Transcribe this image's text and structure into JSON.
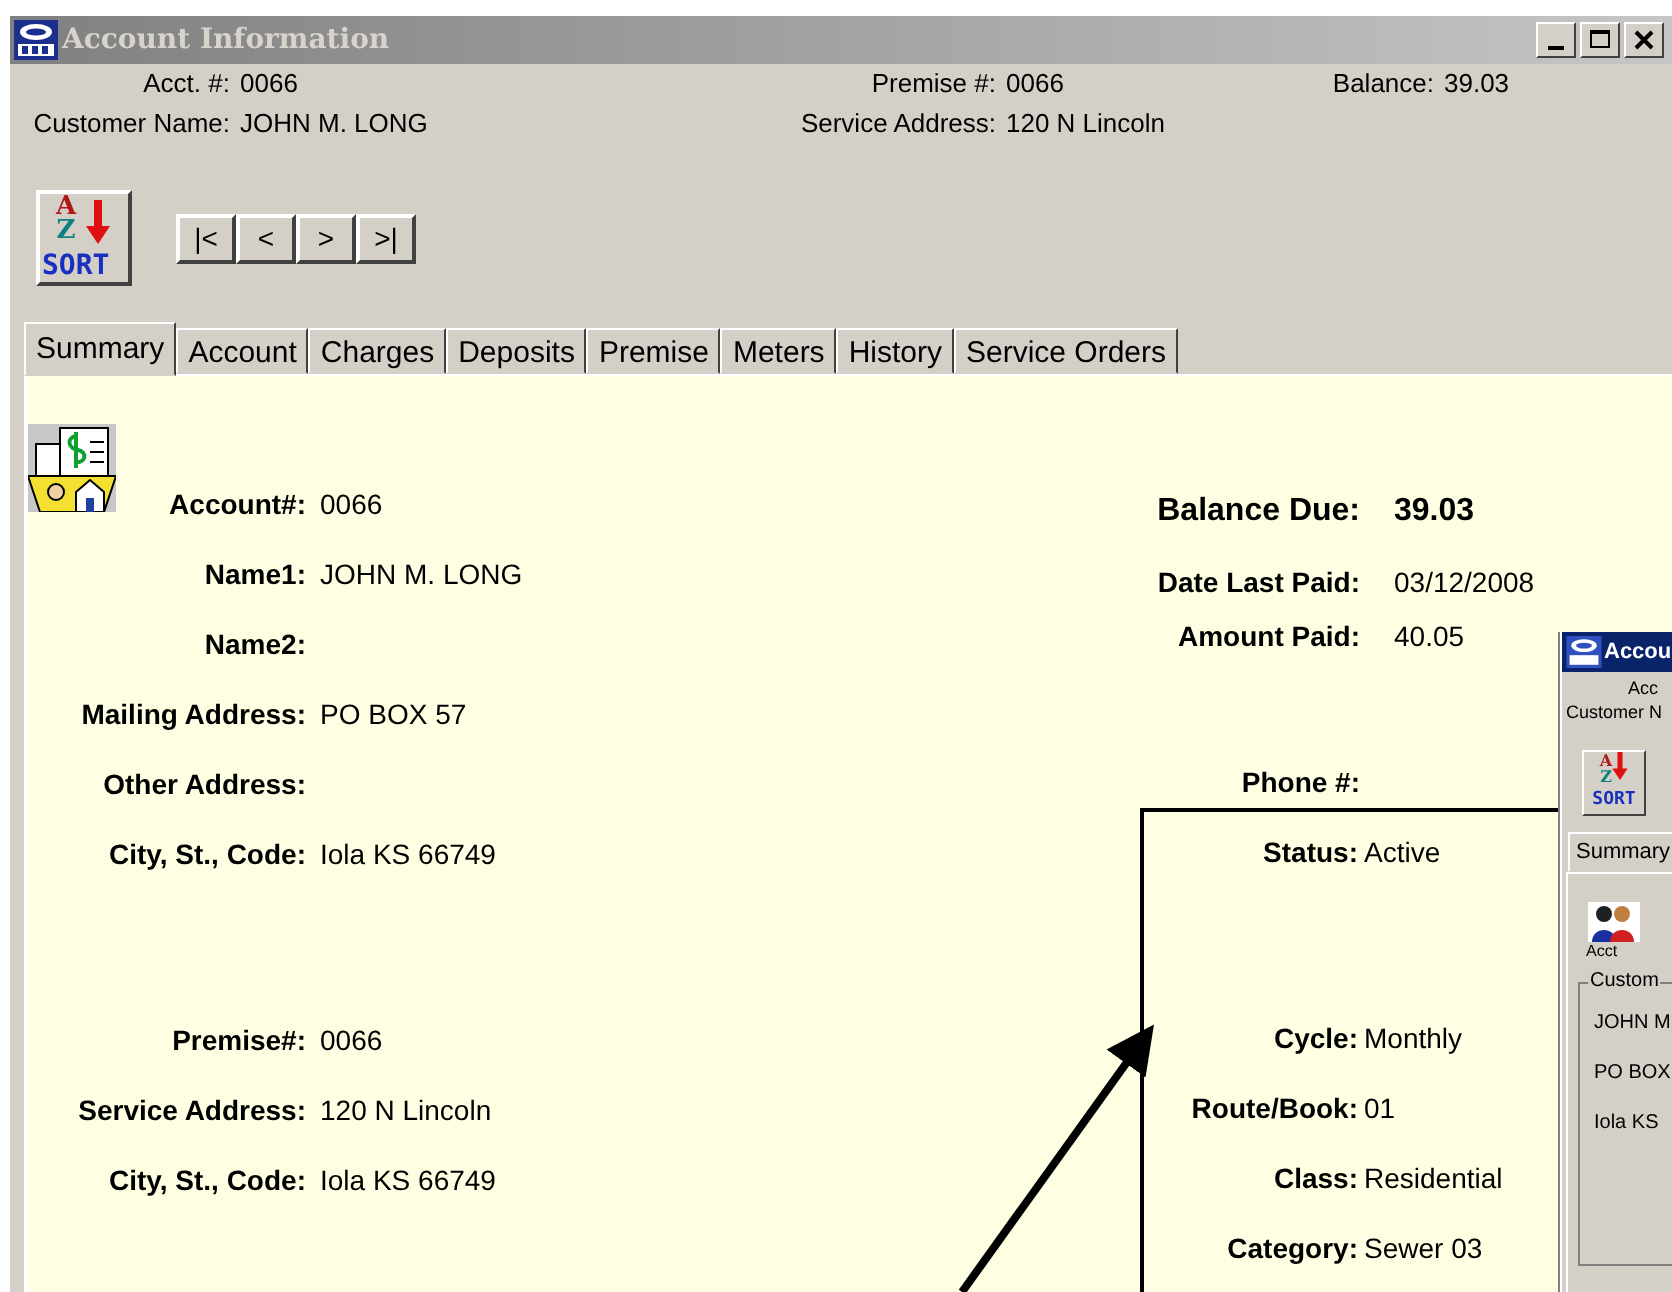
{
  "window": {
    "title": "Account Information"
  },
  "header": {
    "rows": [
      [
        {
          "label": "Acct. #:",
          "value": "0066"
        },
        {
          "label": "Premise #:",
          "value": "0066"
        },
        {
          "label": "Balance:",
          "value": "39.03"
        }
      ],
      [
        {
          "label": "Customer Name:",
          "value": "JOHN M. LONG"
        },
        {
          "label": "Service Address:",
          "value": "120 N Lincoln"
        }
      ]
    ]
  },
  "toolbar": {
    "sort_button": {
      "letters": [
        "A",
        "Z"
      ],
      "label": "SORT"
    },
    "nav_buttons": [
      "|<",
      "<",
      ">",
      ">|"
    ]
  },
  "tabs": [
    {
      "label": "Summary",
      "selected": true
    },
    {
      "label": "Account",
      "selected": false
    },
    {
      "label": "Charges",
      "selected": false
    },
    {
      "label": "Deposits",
      "selected": false
    },
    {
      "label": "Premise",
      "selected": false
    },
    {
      "label": "Meters",
      "selected": false
    },
    {
      "label": "History",
      "selected": false
    },
    {
      "label": "Service Orders",
      "selected": false
    }
  ],
  "account_sections": [
    [
      {
        "label": "Account#:",
        "value": "0066"
      },
      {
        "label": "Name1:",
        "value": "JOHN M. LONG"
      },
      {
        "label": "Name2:"
      },
      {
        "label": "Mailing Address:",
        "value": "PO BOX 57"
      },
      {
        "label": "Other Address:"
      },
      {
        "label": "City, St., Code:",
        "value": "Iola KS 66749"
      }
    ],
    [
      {
        "label": "Premise#:",
        "value": "0066"
      },
      {
        "label": "Service Address:",
        "value": "120 N Lincoln"
      },
      {
        "label": "City, St., Code:",
        "value": "Iola KS 66749"
      }
    ]
  ],
  "balance": {
    "label": "Balance Due:",
    "value": "39.03"
  },
  "payment": [
    {
      "label": "Date Last Paid:",
      "value": "03/12/2008"
    },
    {
      "label": "Amount Paid:",
      "value": "40.05"
    }
  ],
  "phone": {
    "label": "Phone #:"
  },
  "highlight_box": [
    [
      {
        "label": "Status:",
        "value": "Active"
      }
    ],
    [
      {
        "label": "Cycle:",
        "value": "Monthly"
      },
      {
        "label": "Route/Book:",
        "value": "01"
      },
      {
        "label": "Class:",
        "value": "Residential"
      },
      {
        "label": "Category:",
        "value": "Sewer 03"
      }
    ]
  ],
  "second_window": {
    "title": "Accou",
    "header": [
      "Acc",
      "Customer N"
    ],
    "sort_button": {
      "letters": [
        "A",
        "Z"
      ],
      "label": "SORT"
    },
    "tab": "Summary",
    "icon_caption": "Acct",
    "group_title": "Custom",
    "lines": [
      "JOHN M",
      "PO BOX",
      "Iola KS"
    ]
  }
}
